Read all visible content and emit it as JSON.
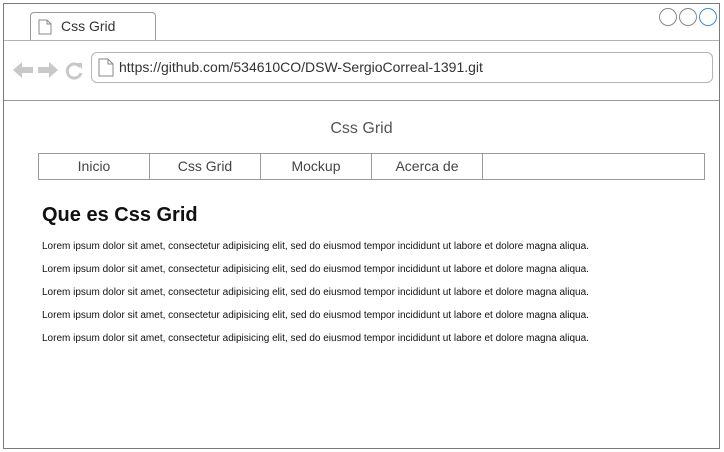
{
  "browser": {
    "tab_title": "Css Grid",
    "url": "https://github.com/534610CO/DSW-SergioCorreal-1391.git"
  },
  "page": {
    "site_title": "Css Grid",
    "menu": [
      {
        "label": "Inicio"
      },
      {
        "label": "Css Grid"
      },
      {
        "label": "Mockup"
      },
      {
        "label": "Acerca de"
      }
    ],
    "heading": "Que es Css Grid",
    "paragraphs": [
      "Lorem ipsum dolor sit amet, consectetur adipisicing elit, sed do eiusmod tempor incididunt ut labore et dolore magna aliqua.",
      "Lorem ipsum dolor sit amet, consectetur adipisicing elit, sed do eiusmod tempor incididunt ut labore et dolore magna aliqua.",
      "Lorem ipsum dolor sit amet, consectetur adipisicing elit, sed do eiusmod tempor incididunt ut labore et dolore magna aliqua.",
      "Lorem ipsum dolor sit amet, consectetur adipisicing elit, sed do eiusmod tempor incididunt ut labore et dolore magna aliqua.",
      "Lorem ipsum dolor sit amet, consectetur adipisicing elit, sed do eiusmod tempor incididunt ut labore et dolore magna aliqua."
    ]
  },
  "icons": {
    "tab": "page-icon",
    "back": "arrow-left-icon",
    "forward": "arrow-right-icon",
    "reload": "reload-icon",
    "url": "page-icon"
  },
  "colors": {
    "frame_border": "#7a7a7a",
    "nav_icon": "#c8c8c8",
    "active_window_button": "#3a8fd8"
  }
}
